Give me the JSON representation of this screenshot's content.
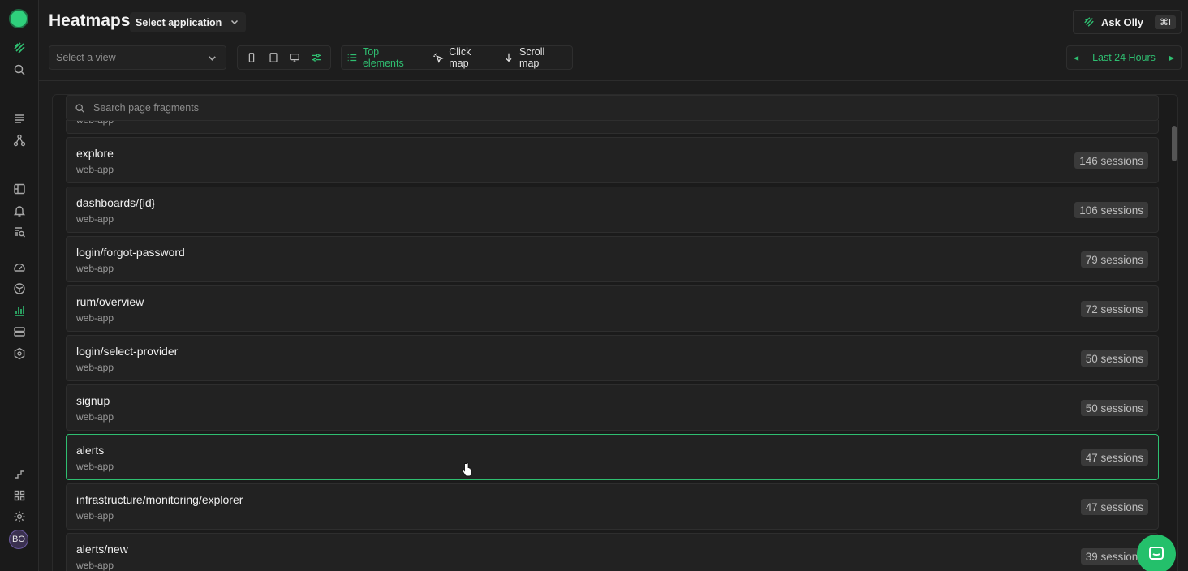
{
  "header": {
    "title": "Heatmaps",
    "app_select": "Select application",
    "ask": {
      "label": "Ask Olly",
      "shortcut": "⌘I"
    },
    "view_select_placeholder": "Select a view",
    "modes": [
      "Top elements",
      "Click map",
      "Scroll map"
    ],
    "time_range": "Last 24 Hours"
  },
  "search": {
    "placeholder": "Search page fragments"
  },
  "sidebar": {
    "avatar": "BO"
  },
  "rows": [
    {
      "title": "",
      "sub": "web-app",
      "badge": ""
    },
    {
      "title": "explore",
      "sub": "web-app",
      "badge": "146 sessions"
    },
    {
      "title": "dashboards/{id}",
      "sub": "web-app",
      "badge": "106 sessions"
    },
    {
      "title": "login/forgot-password",
      "sub": "web-app",
      "badge": "79 sessions"
    },
    {
      "title": "rum/overview",
      "sub": "web-app",
      "badge": "72 sessions"
    },
    {
      "title": "login/select-provider",
      "sub": "web-app",
      "badge": "50 sessions"
    },
    {
      "title": "signup",
      "sub": "web-app",
      "badge": "50 sessions"
    },
    {
      "title": "alerts",
      "sub": "web-app",
      "badge": "47 sessions"
    },
    {
      "title": "infrastructure/monitoring/explorer",
      "sub": "web-app",
      "badge": "47 sessions"
    },
    {
      "title": "alerts/new",
      "sub": "web-app",
      "badge": "39 sessions"
    }
  ],
  "colors": {
    "accent": "#2fbf71",
    "background": "#1d1d1d"
  }
}
